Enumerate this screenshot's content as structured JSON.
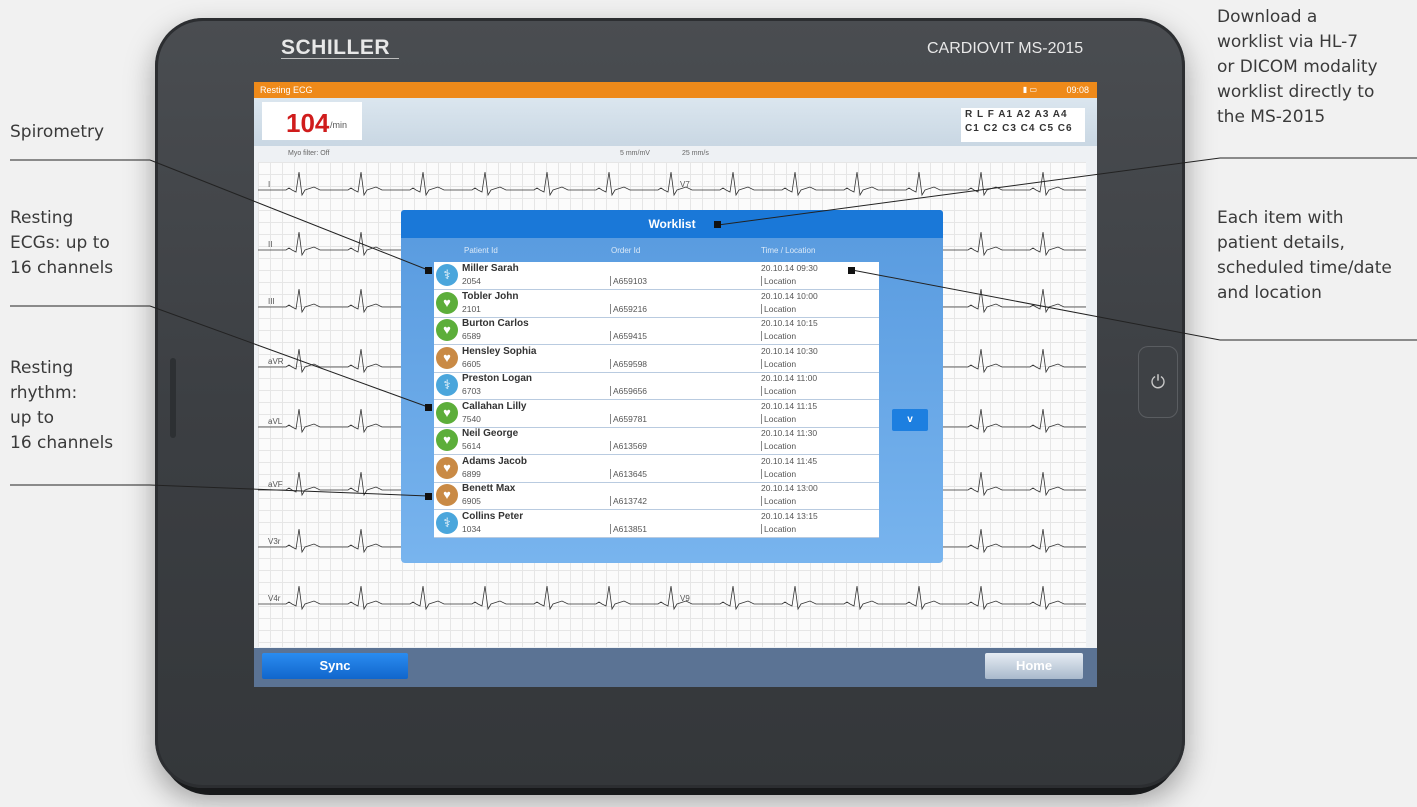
{
  "annotations": {
    "download": [
      "Download a",
      "worklist via HL-7",
      "or DICOM modality",
      "worklist directly to",
      "the MS-2015"
    ],
    "spirometry": [
      "Spirometry"
    ],
    "resting_ecg": [
      "Resting",
      "ECGs: up to",
      "16 channels"
    ],
    "resting_rhythm": [
      "Resting",
      "rhythm:",
      "up to",
      "16 channels"
    ],
    "each_item": [
      "Each item with",
      "patient details,",
      "scheduled time/date",
      "and location"
    ]
  },
  "device": {
    "brand": "SCHILLER",
    "model": "CARDIOVIT MS-2015"
  },
  "screen": {
    "mode_title": "Resting ECG",
    "clock": "09:08",
    "heart_rate": "104",
    "heart_rate_unit": "/min",
    "myo_filter": "Myo filter:  Off",
    "sensitivity": "5 mm/mV",
    "speed": "25 mm/s",
    "leads_row1": "R L F A1 A2 A3 A4",
    "leads_row2": "C1 C2 C3 C4 C5 C6",
    "lead_labels": [
      "I",
      "II",
      "III",
      "aVR",
      "aVL",
      "aVF",
      "V3r",
      "V4r",
      "V7",
      "V9"
    ],
    "sync_label": "Sync",
    "home_label": "Home"
  },
  "worklist": {
    "title": "Worklist",
    "col_patient": "Patient Id",
    "col_order": "Order Id",
    "col_time": "Time / Location",
    "scroll_label": "v",
    "rows": [
      {
        "name": "Miller Sarah",
        "pid": "2054",
        "oid": "A659103",
        "time": "20.10.14 09:30",
        "loc": "Location",
        "type": "spirometry"
      },
      {
        "name": "Tobler John",
        "pid": "2101",
        "oid": "A659216",
        "time": "20.10.14 10:00",
        "loc": "Location",
        "type": "ecg"
      },
      {
        "name": "Burton Carlos",
        "pid": "6589",
        "oid": "A659415",
        "time": "20.10.14 10:15",
        "loc": "Location",
        "type": "ecg"
      },
      {
        "name": "Hensley Sophia",
        "pid": "6605",
        "oid": "A659598",
        "time": "20.10.14 10:30",
        "loc": "Location",
        "type": "rhythm"
      },
      {
        "name": "Preston Logan",
        "pid": "6703",
        "oid": "A659656",
        "time": "20.10.14 11:00",
        "loc": "Location",
        "type": "spirometry"
      },
      {
        "name": "Callahan Lilly",
        "pid": "7540",
        "oid": "A659781",
        "time": "20.10.14 11:15",
        "loc": "Location",
        "type": "ecg"
      },
      {
        "name": "Neil George",
        "pid": "5614",
        "oid": "A613569",
        "time": "20.10.14 11:30",
        "loc": "Location",
        "type": "ecg"
      },
      {
        "name": "Adams Jacob",
        "pid": "6899",
        "oid": "A613645",
        "time": "20.10.14 11:45",
        "loc": "Location",
        "type": "rhythm"
      },
      {
        "name": "Benett Max",
        "pid": "6905",
        "oid": "A613742",
        "time": "20.10.14 13:00",
        "loc": "Location",
        "type": "rhythm"
      },
      {
        "name": "Collins Peter",
        "pid": "1034",
        "oid": "A613851",
        "time": "20.10.14 13:15",
        "loc": "Location",
        "type": "spirometry"
      }
    ]
  },
  "colors": {
    "spirometry": "#4aa6dc",
    "ecg": "#5cae3a",
    "rhythm": "#c98a45",
    "accent": "#ee8a1a",
    "heart_rate": "#d01c1c"
  }
}
